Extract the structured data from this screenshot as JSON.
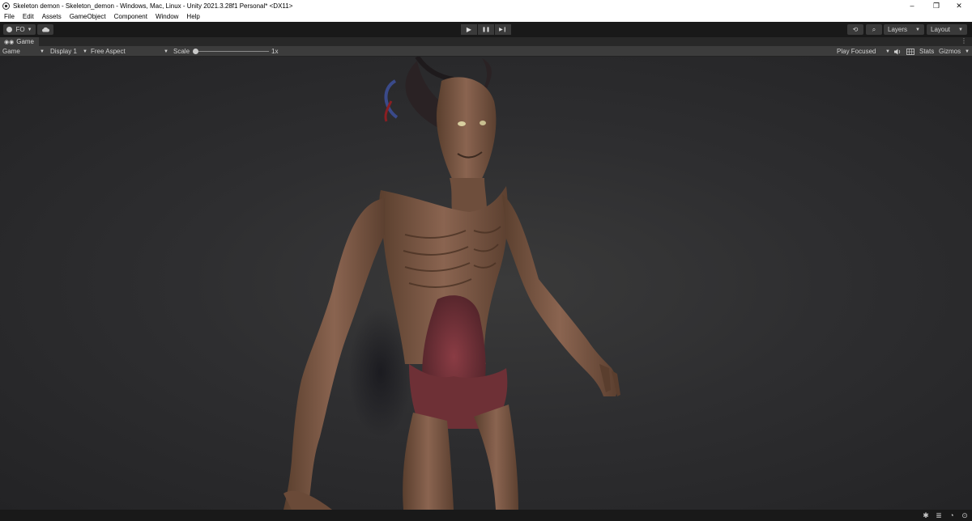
{
  "window": {
    "title": "Skeleton demon - Skeleton_demon - Windows, Mac, Linux - Unity 2021.3.28f1 Personal* <DX11>",
    "controls": {
      "minimize": "–",
      "restore": "❐",
      "close": "✕"
    }
  },
  "menu": {
    "items": [
      "File",
      "Edit",
      "Assets",
      "GameObject",
      "Component",
      "Window",
      "Help"
    ]
  },
  "toolbar": {
    "account_label": "FO",
    "play": "▶",
    "pause": "❚❚",
    "step": "▶❙",
    "history": "⟲",
    "search": "⌕",
    "layers_label": "Layers",
    "layout_label": "Layout"
  },
  "tab": {
    "label": "Game",
    "menu": "⋮"
  },
  "game_controls": {
    "view_mode": "Game",
    "display": "Display 1",
    "aspect": "Free Aspect",
    "scale_label": "Scale",
    "scale_value": "1x",
    "scale_level": 0,
    "play_mode": "Play Focused",
    "stats_label": "Stats",
    "gizmos_label": "Gizmos"
  },
  "icons": {
    "account": "account-icon",
    "cloud": "cloud-icon",
    "history": "history-icon",
    "search": "search-icon",
    "gamepad": "gamepad-icon",
    "audio": "audio-icon",
    "stats_grid": "grid-icon"
  },
  "colors": {
    "editor_dark": "#191919",
    "panel": "#3c3c3c",
    "viewport_bg": "#2e2e30"
  }
}
